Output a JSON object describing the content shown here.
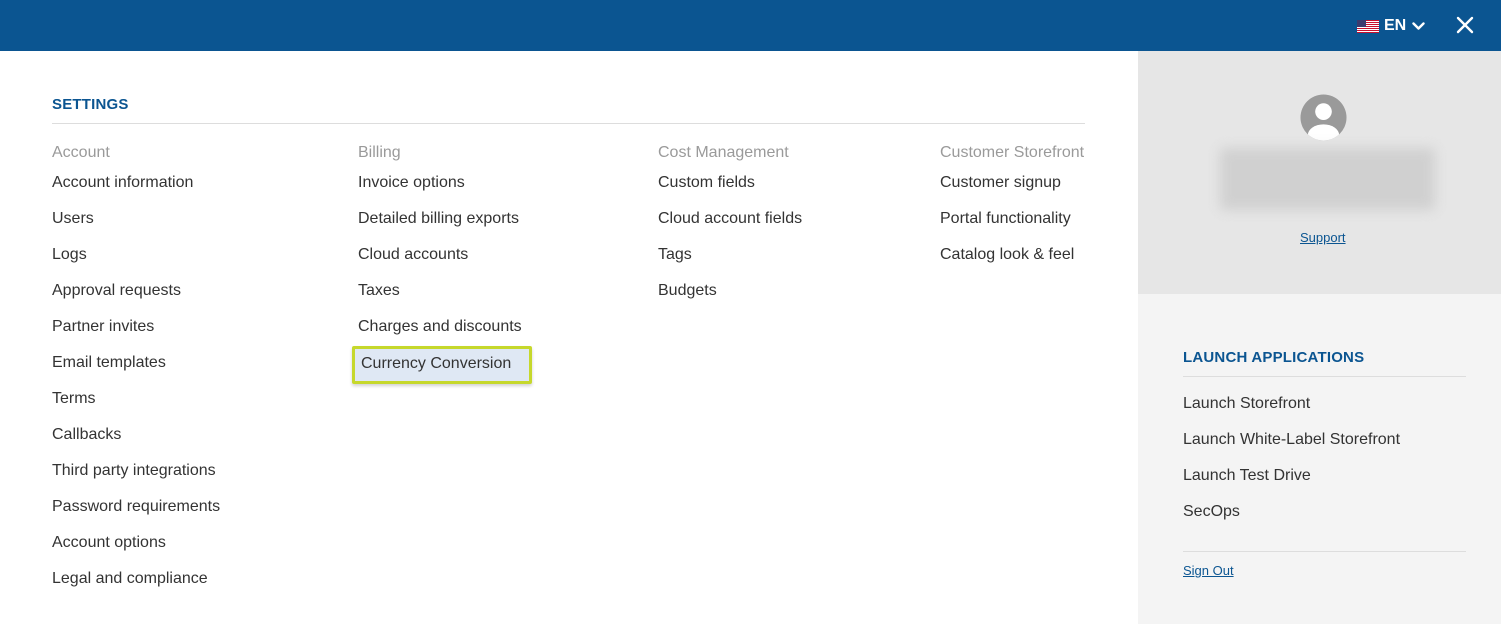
{
  "header": {
    "language_code": "EN",
    "bg_color": "#0b5591",
    "flag_icon": "us-flag-icon",
    "dropdown_icon": "chevron-down-icon",
    "close_icon": "close-icon"
  },
  "settings": {
    "title": "SETTINGS",
    "columns": [
      {
        "heading": "Account",
        "items": [
          "Account information",
          "Users",
          "Logs",
          "Approval requests",
          "Partner invites",
          "Email templates",
          "Terms",
          "Callbacks",
          "Third party integrations",
          "Password requirements",
          "Account options",
          "Legal and compliance"
        ]
      },
      {
        "heading": "Billing",
        "items": [
          "Invoice options",
          "Detailed billing exports",
          "Cloud accounts",
          "Taxes",
          "Charges and discounts",
          "Currency Conversion"
        ]
      },
      {
        "heading": "Cost Management",
        "items": [
          "Custom fields",
          "Cloud account fields",
          "Tags",
          "Budgets"
        ]
      },
      {
        "heading": "Customer Storefront",
        "items": [
          "Customer signup",
          "Portal functionality",
          "Catalog look & feel"
        ]
      }
    ],
    "highlighted_item": "Currency Conversion",
    "highlight_color": "#c6d82c"
  },
  "profile": {
    "avatar_icon": "user-avatar-icon",
    "support_label": "Support"
  },
  "launch": {
    "title": "LAUNCH APPLICATIONS",
    "items": [
      "Launch Storefront",
      "Launch White-Label Storefront",
      "Launch Test Drive",
      "SecOps"
    ],
    "sign_out_label": "Sign Out"
  }
}
